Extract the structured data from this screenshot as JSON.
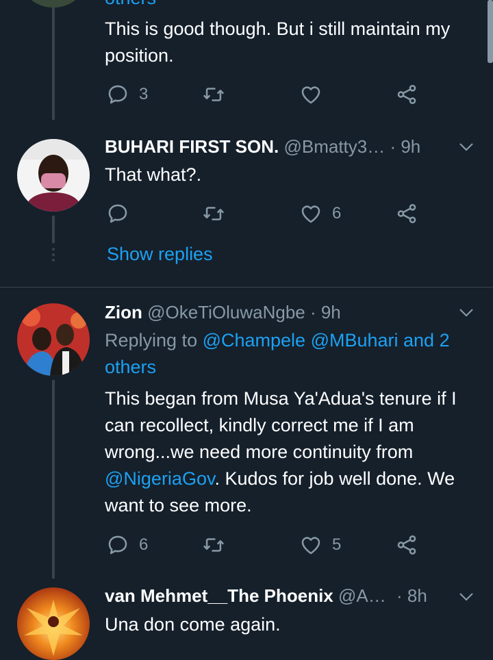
{
  "tweet1": {
    "partial_header": "others",
    "text": "This is good though. But i still maintain my position.",
    "reply_count": "3",
    "retweet_count": "",
    "like_count": ""
  },
  "tweet2": {
    "name": "BUHARI FIRST SON.",
    "handle": "@Bmatty3…",
    "time": "· 9h",
    "text": "That what?.",
    "reply_count": "",
    "retweet_count": "",
    "like_count": "6",
    "show_replies": "Show replies"
  },
  "tweet3": {
    "name": "Zion",
    "handle": "@OkeTiOluwaNgbe",
    "time": "· 9h",
    "replying_prefix": "Replying to ",
    "replying_users": "@Champele @MBuhari and 2 others",
    "text_before": "This began from Musa Ya'Adua's tenure if I can recollect, kindly correct me if I am wrong...we need more continuity from ",
    "mention": "@NigeriaGov",
    "text_after": ". Kudos for job well done. We want to see more.",
    "reply_count": "6",
    "retweet_count": "",
    "like_count": "5"
  },
  "tweet4": {
    "name": "van Mehmet__The Phoenix",
    "handle": "@A…",
    "time": "· 8h",
    "text": "Una don come again."
  },
  "colors": {
    "background": "#15202b",
    "muted": "#8899a6",
    "accent": "#1da1f2",
    "divider": "#38444d"
  },
  "icons": [
    "reply-icon",
    "retweet-icon",
    "like-icon",
    "share-icon",
    "chevron-down-icon"
  ]
}
